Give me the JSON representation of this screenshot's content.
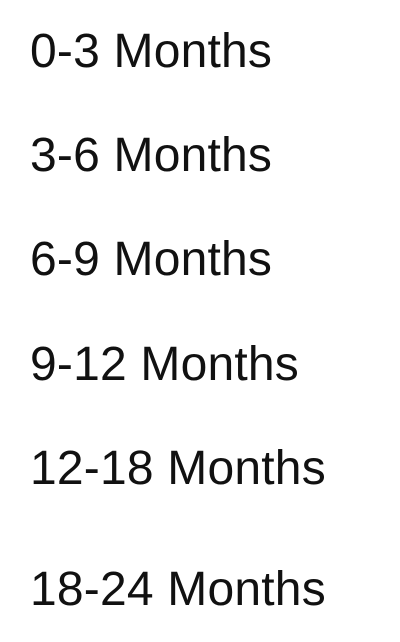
{
  "size_filter": {
    "options": [
      "0-3 Months",
      "3-6 Months",
      "6-9 Months",
      "9-12 Months",
      "12-18 Months",
      "18-24 Months"
    ]
  }
}
